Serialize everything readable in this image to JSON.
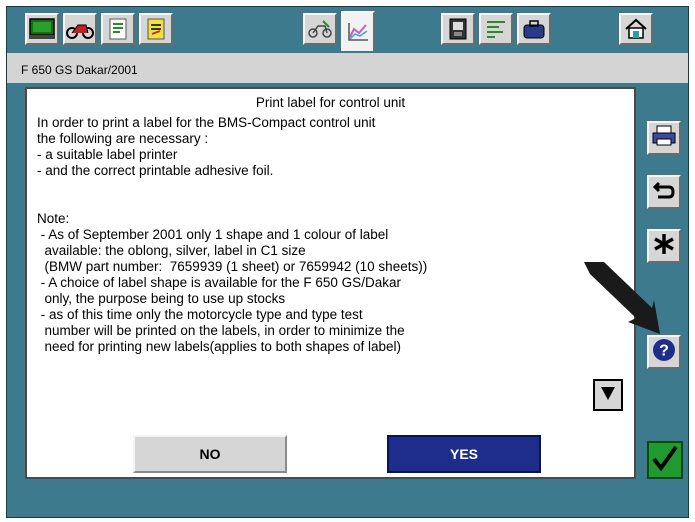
{
  "header": {
    "vehicle": "F 650 GS Dakar/2001"
  },
  "toolbar": {
    "tabs": [
      {
        "icon": "monitor-icon"
      },
      {
        "icon": "motorcycle-icon"
      },
      {
        "icon": "document-list-icon"
      },
      {
        "icon": "document-edit-icon"
      },
      {
        "icon": "motorcycle-service-icon"
      },
      {
        "icon": "chart-graph-icon"
      },
      {
        "icon": "control-unit-icon"
      },
      {
        "icon": "text-list-icon"
      },
      {
        "icon": "toolbox-icon"
      },
      {
        "icon": "home-phone-icon"
      }
    ]
  },
  "dialog": {
    "title": "Print label for control unit",
    "lines": [
      "In order to print a label for the BMS-Compact control unit",
      "the following are necessary :",
      "- a suitable label printer",
      "- and the correct printable adhesive foil.",
      "",
      "",
      "Note:",
      " - As of September 2001 only 1 shape and 1 colour of label",
      "  available: the oblong, silver, label in C1 size",
      "  (BMW part number:  7659939 (1 sheet) or 7659942 (10 sheets))",
      " - A choice of label shape is available for the F 650 GS/Dakar",
      "  only, the purpose being to use up stocks",
      " - as of this time only the motorcycle type and type test",
      "  number will be printed on the labels, in order to minimize the",
      "  need for printing new labels(applies to both shapes of label)"
    ],
    "no_label": "NO",
    "yes_label": "YES"
  },
  "sidebar": {
    "buttons": [
      {
        "icon": "printer-icon"
      },
      {
        "icon": "back-arrow-icon"
      },
      {
        "icon": "asterisk-icon"
      },
      {
        "icon": "help-icon"
      },
      {
        "icon": "checkmark-icon"
      }
    ]
  },
  "colors": {
    "frame": "#3e7a8e",
    "yes_button": "#1e2d8c",
    "confirm": "#1e9a2e"
  }
}
